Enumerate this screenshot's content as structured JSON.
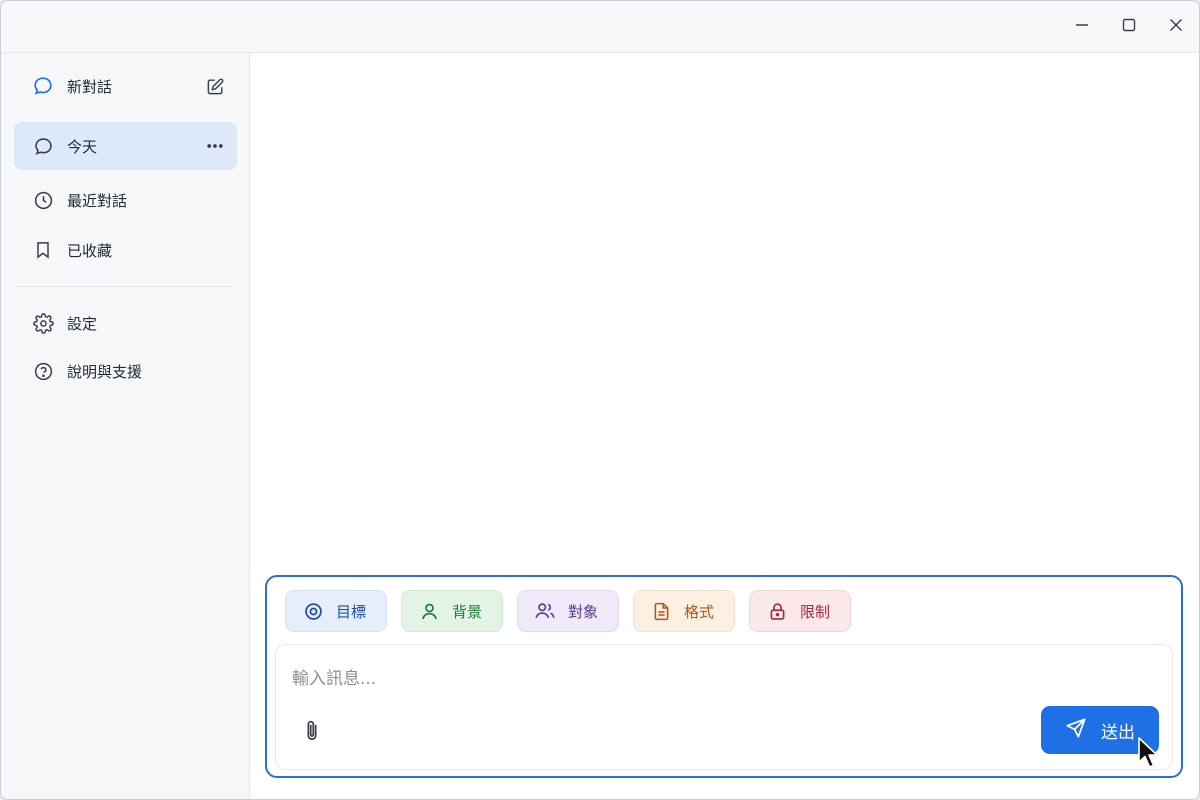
{
  "window_controls": {
    "minimize_icon": "minimize-icon",
    "maximize_icon": "maximize-icon",
    "close_icon": "close-icon"
  },
  "sidebar": {
    "new_chat": {
      "label": "新對話",
      "icon": "chat-bubble-icon",
      "action_icon": "edit-icon"
    },
    "items": [
      {
        "label": "今天",
        "icon": "chat-bubble-icon",
        "active": true,
        "trailing_icon": "more-horizontal-icon"
      },
      {
        "label": "最近對話",
        "icon": "clock-icon"
      },
      {
        "label": "已收藏",
        "icon": "bookmark-icon"
      }
    ],
    "footer_items": [
      {
        "label": "設定",
        "icon": "gear-icon"
      },
      {
        "label": "說明與支援",
        "icon": "help-circle-icon"
      }
    ]
  },
  "composer": {
    "chips": [
      {
        "label": "目標",
        "icon": "target-icon",
        "color": "#1f4fa8"
      },
      {
        "label": "背景",
        "icon": "person-icon",
        "color": "#217a3a"
      },
      {
        "label": "對象",
        "icon": "people-icon",
        "color": "#5b3b9b"
      },
      {
        "label": "格式",
        "icon": "document-icon",
        "color": "#b4561a"
      },
      {
        "label": "限制",
        "icon": "lock-icon",
        "color": "#a52a3b"
      }
    ],
    "input": {
      "value": "",
      "placeholder": "輸入訊息..."
    },
    "attach_icon": "paperclip-icon",
    "send": {
      "label": "送出",
      "icon": "send-icon"
    }
  },
  "colors": {
    "accent": "#1f6fe5",
    "active_item_bg": "#dde8f8",
    "composer_border": "#2b6fd6"
  }
}
